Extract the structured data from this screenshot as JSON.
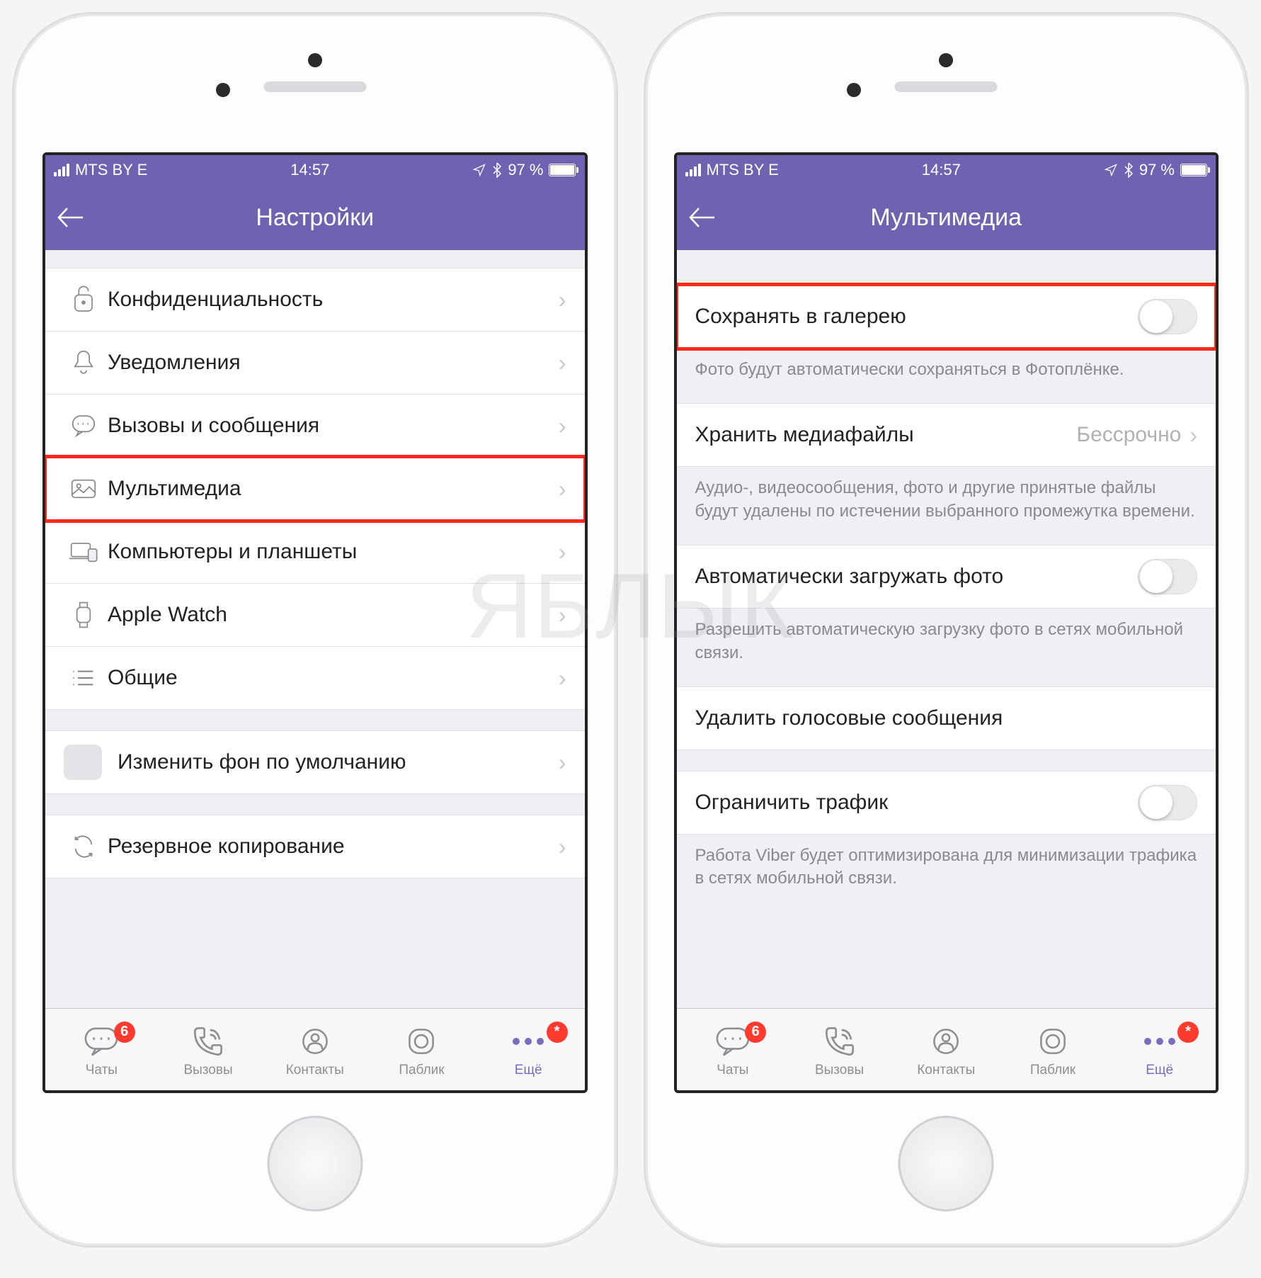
{
  "statusbar": {
    "carrier": "MTS BY  E",
    "time": "14:57",
    "battery_pct": "97 %"
  },
  "left_phone": {
    "title": "Настройки",
    "items": [
      {
        "label": "Конфиденциальность"
      },
      {
        "label": "Уведомления"
      },
      {
        "label": "Вызовы и сообщения"
      },
      {
        "label": "Мультимедиа"
      },
      {
        "label": "Компьютеры и планшеты"
      },
      {
        "label": "Apple Watch"
      },
      {
        "label": "Общие"
      }
    ],
    "bg_row": "Изменить фон по умолчанию",
    "backup_row": "Резервное копирование"
  },
  "right_phone": {
    "title": "Мультимедиа",
    "save_gallery": "Сохранять в галерею",
    "save_gallery_footer": "Фото будут автоматически сохраняться в Фотоплёнке.",
    "store_media_label": "Хранить медиафайлы",
    "store_media_value": "Бессрочно",
    "store_media_footer": "Аудио-, видеосообщения, фото и другие принятые файлы будут удалены по истечении выбранного промежутка времени.",
    "auto_dl": "Автоматически загружать фото",
    "auto_dl_footer": "Разрешить автоматическую загрузку фото в сетях мобильной связи.",
    "del_voice": "Удалить голосовые сообщения",
    "limit_traffic": "Ограничить трафик",
    "limit_footer": "Работа Viber будет оптимизирована для минимизации трафика в сетях мобильной связи."
  },
  "tabs": {
    "chats": "Чаты",
    "calls": "Вызовы",
    "contacts": "Контакты",
    "public": "Паблик",
    "more": "Ещё",
    "chats_badge": "6",
    "more_badge": "*"
  },
  "watermark": "ЯБЛЫК"
}
